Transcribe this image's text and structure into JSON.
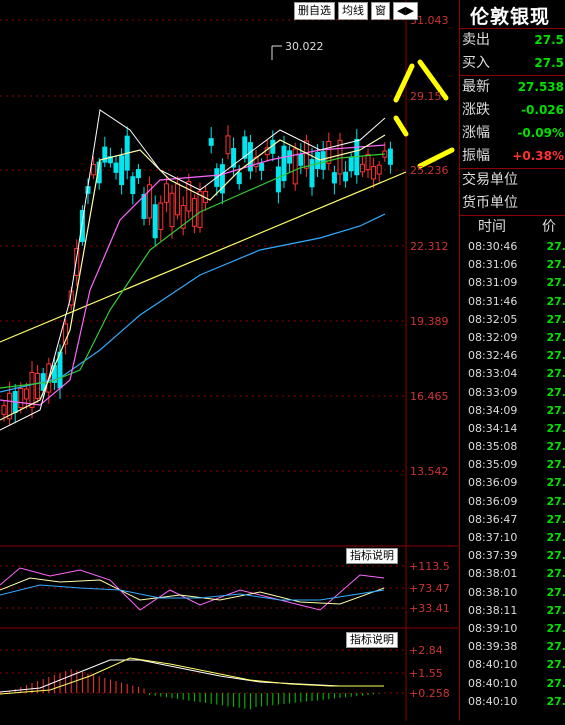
{
  "toolbar": {
    "btn1": "删自选",
    "btn2": "均线",
    "btn3": "窗",
    "btn4": "◀▶"
  },
  "price_axis": [
    "31.043",
    "29.15",
    "25.236",
    "22.312",
    "19.389",
    "16.465",
    "13.542"
  ],
  "annotation_high": "30.022",
  "indicator1": {
    "btn": "指标说明",
    "labels": [
      "+113.5",
      "+73.47",
      "+33.41"
    ]
  },
  "indicator2": {
    "btn": "指标说明",
    "labels": [
      "+2.84",
      "+1.55",
      "+0.258"
    ]
  },
  "side": {
    "title": "伦敦银现",
    "quotes": [
      {
        "k": "卖出",
        "v": "27.5",
        "color": "#00e000"
      },
      {
        "k": "买入",
        "v": "27.5",
        "color": "#00e000"
      },
      {
        "k": "最新",
        "v": "27.538",
        "color": "#00e000"
      },
      {
        "k": "涨跌",
        "v": "-0.026",
        "color": "#00e000"
      },
      {
        "k": "涨幅",
        "v": "-0.09%",
        "color": "#00e000"
      },
      {
        "k": "振幅",
        "v": "+0.38%",
        "color": "#ff3333"
      },
      {
        "k": "交易单位",
        "v": "",
        "color": "#ddd"
      },
      {
        "k": "货币单位",
        "v": "",
        "color": "#ddd"
      }
    ],
    "trade_head": [
      "时间",
      "价"
    ],
    "trades": [
      {
        "t": "08:30:46",
        "p": "27."
      },
      {
        "t": "08:31:06",
        "p": "27."
      },
      {
        "t": "08:31:09",
        "p": "27."
      },
      {
        "t": "08:31:46",
        "p": "27."
      },
      {
        "t": "08:32:05",
        "p": "27."
      },
      {
        "t": "08:32:09",
        "p": "27."
      },
      {
        "t": "08:32:46",
        "p": "27."
      },
      {
        "t": "08:33:04",
        "p": "27."
      },
      {
        "t": "08:33:09",
        "p": "27."
      },
      {
        "t": "08:34:09",
        "p": "27."
      },
      {
        "t": "08:34:14",
        "p": "27."
      },
      {
        "t": "08:35:08",
        "p": "27."
      },
      {
        "t": "08:35:09",
        "p": "27."
      },
      {
        "t": "08:36:09",
        "p": "27."
      },
      {
        "t": "08:36:09",
        "p": "27."
      },
      {
        "t": "08:36:47",
        "p": "27."
      },
      {
        "t": "08:37:10",
        "p": "27."
      },
      {
        "t": "08:37:39",
        "p": "27."
      },
      {
        "t": "08:38:01",
        "p": "27."
      },
      {
        "t": "08:38:10",
        "p": "27."
      },
      {
        "t": "08:38:11",
        "p": "27."
      },
      {
        "t": "08:39:10",
        "p": "27."
      },
      {
        "t": "08:39:38",
        "p": "27."
      },
      {
        "t": "08:40:10",
        "p": "27."
      },
      {
        "t": "08:40:10",
        "p": "27."
      },
      {
        "t": "08:40:10",
        "p": "27."
      }
    ]
  }
}
